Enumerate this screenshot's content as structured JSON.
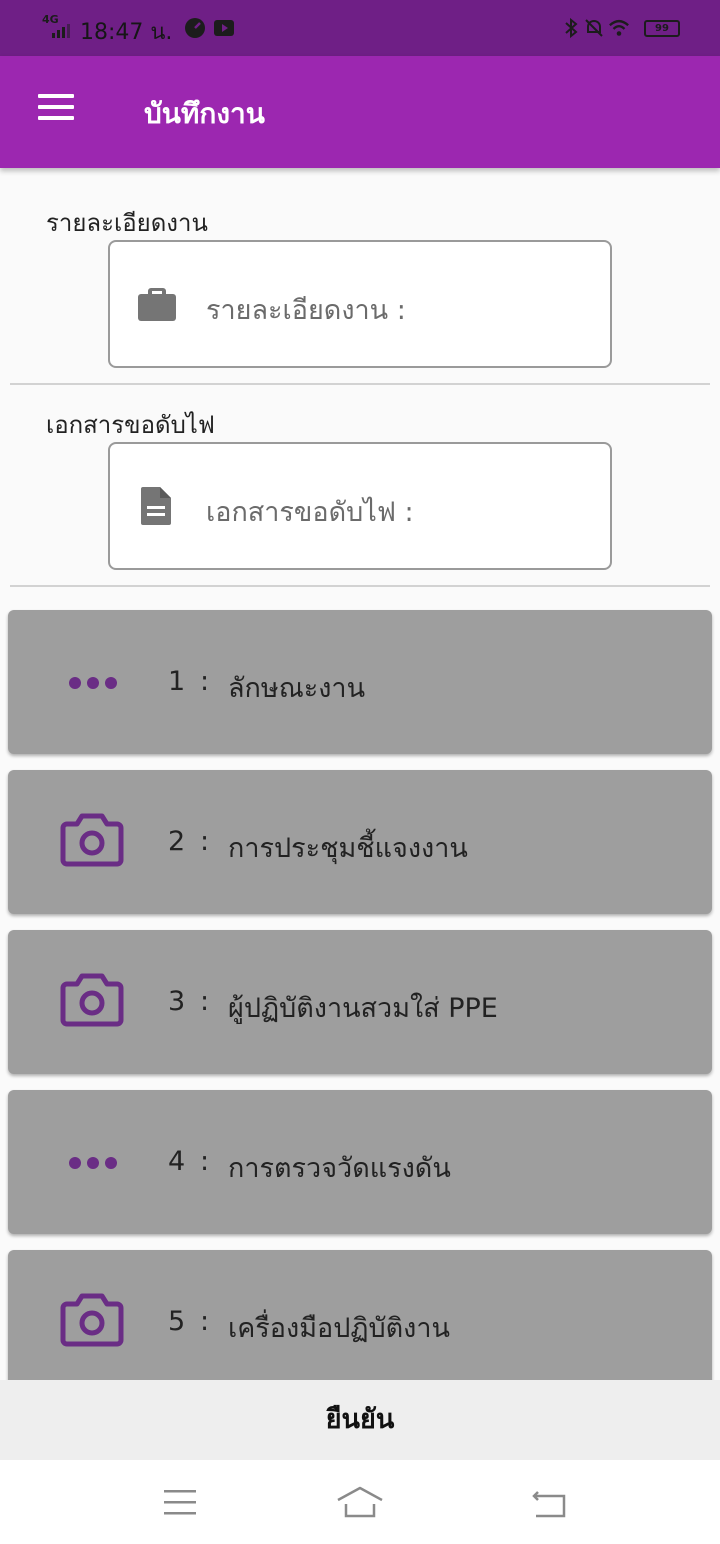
{
  "status_bar": {
    "network": "4G",
    "time": "18:47 น.",
    "battery": "99"
  },
  "app_bar": {
    "title": "บันทึกงาน"
  },
  "fields": [
    {
      "label": "รายละเอียดงาน",
      "placeholder": "รายละเอียดงาน :",
      "icon": "briefcase-icon"
    },
    {
      "label": "เอกสารขอดับไฟ",
      "placeholder": "เอกสารขอดับไฟ :",
      "icon": "document-icon"
    }
  ],
  "steps": [
    {
      "number": "1",
      "separator": ":",
      "label": "ลักษณะงาน",
      "icon": "more-dots-icon"
    },
    {
      "number": "2",
      "separator": ":",
      "label": "การประชุมชี้แจงงาน",
      "icon": "camera-icon"
    },
    {
      "number": "3",
      "separator": ":",
      "label": "ผู้ปฏิบัติงานสวมใส่ PPE",
      "icon": "camera-icon"
    },
    {
      "number": "4",
      "separator": ":",
      "label": "การตรวจวัดแรงดัน",
      "icon": "more-dots-icon"
    },
    {
      "number": "5",
      "separator": ":",
      "label": "เครื่องมือปฏิบัติงาน",
      "icon": "camera-icon"
    }
  ],
  "confirm_button": {
    "label": "ยืนยัน"
  },
  "colors": {
    "status_bar": "#6f1f86",
    "app_bar": "#9c27b0",
    "card": "#9e9e9e",
    "icon_accent": "#6a2d85"
  }
}
